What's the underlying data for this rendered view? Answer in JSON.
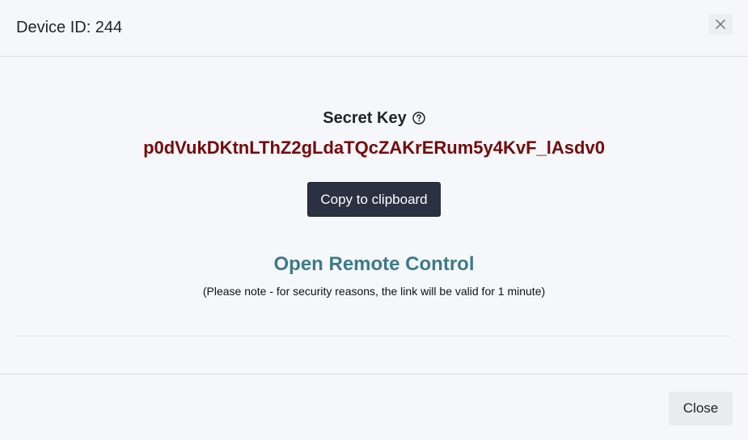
{
  "header": {
    "title": "Device ID: 244",
    "close_icon": "close-icon"
  },
  "body": {
    "secret_key_label": "Secret Key",
    "help_icon": "question-circle-icon",
    "secret_key_value": "p0dVukDKtnLThZ2gLdaTQcZAKrERum5y4KvF_lAsdv0",
    "copy_button_label": "Copy to clipboard",
    "remote_control_link": "Open Remote Control",
    "note": "(Please note - for security reasons, the link will be valid for 1 minute)"
  },
  "footer": {
    "close_button_label": "Close"
  },
  "colors": {
    "secret_value": "#760a0a",
    "link": "#3a7c89",
    "primary_button": "#2b3140",
    "background": "#f6f7fa"
  }
}
